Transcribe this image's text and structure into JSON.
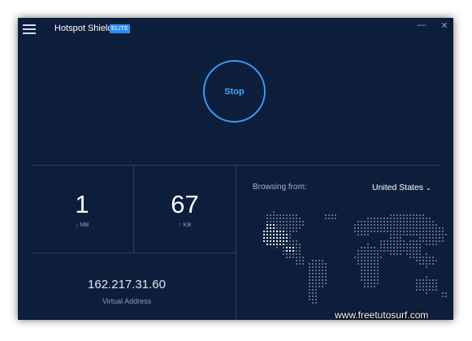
{
  "app": {
    "title": "Hotspot Shield",
    "badge": "ELITE"
  },
  "window_controls": {
    "minimize": "—",
    "close": "✕"
  },
  "connect_button": {
    "label": "Stop"
  },
  "stats": {
    "download": {
      "value": "1",
      "unit": "MB",
      "arrow": "↓"
    },
    "upload": {
      "value": "67",
      "unit": "KB",
      "arrow": "↑"
    }
  },
  "ip": {
    "address": "162.217.31.60",
    "label": "Virtual Address"
  },
  "browsing": {
    "label": "Browsing from:",
    "location": "United States",
    "chevron": "⌄"
  },
  "colors": {
    "background": "#0c1e3c",
    "accent": "#3d9af2",
    "map_dot": "#5e6f88",
    "map_highlight": "#f2f5fa"
  },
  "icons": [
    "hamburger-menu-icon",
    "minimize-icon",
    "close-icon",
    "download-arrow-icon",
    "upload-arrow-icon",
    "chevron-down-icon"
  ],
  "watermark": "www.freetutosurf.com"
}
